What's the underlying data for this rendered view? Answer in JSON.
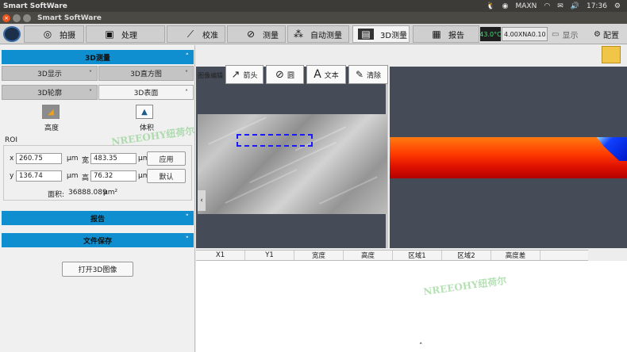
{
  "system": {
    "app": "Smart SoftWare",
    "indicators": [
      "MAXN"
    ],
    "time": "17:36"
  },
  "window": {
    "title": "Smart SoftWare"
  },
  "tabs": [
    {
      "label": "拍摄",
      "icon": "camera-icon"
    },
    {
      "label": "处理",
      "icon": "image-icon"
    },
    {
      "label": "校准",
      "icon": "ruler-icon"
    },
    {
      "label": "测量",
      "icon": "measure-icon"
    },
    {
      "label": "自动测量",
      "icon": "auto-measure-icon"
    },
    {
      "label": "3D测量",
      "icon": "3d-icon",
      "active": true
    },
    {
      "label": "报告",
      "icon": "report-icon"
    }
  ],
  "status": {
    "temp": "43.0°C",
    "mode": "4.00XNA0.10",
    "display": "显示",
    "config": "配置"
  },
  "left": {
    "section_3d": "3D测量",
    "sub": {
      "display": "3D显示",
      "histogram": "3D直方图",
      "contour": "3D轮廓",
      "surface": "3D表面"
    },
    "height": "高度",
    "volume": "体积",
    "roi": "ROI",
    "x_label": "x",
    "x_val": "260.75",
    "y_label": "y",
    "y_val": "136.74",
    "w_label": "宽",
    "w_val": "483.35",
    "h_label": "高",
    "h_val": "76.32",
    "unit": "μm",
    "apply": "应用",
    "default": "默认",
    "area_label": "面积:",
    "area_val": "36888.089",
    "area_unit": "μm²",
    "report": "报告",
    "save": "文件保存",
    "open3d": "打开3D图像"
  },
  "edit": {
    "label": "图像编辑",
    "arrow": "箭头",
    "circle": "圆",
    "text": "文本",
    "clear": "清除"
  },
  "table": {
    "headers": [
      "X1",
      "Y1",
      "宽度",
      "高度",
      "区域1",
      "区域2",
      "高度差"
    ]
  },
  "watermark": "NREEOHY纽荷尔"
}
